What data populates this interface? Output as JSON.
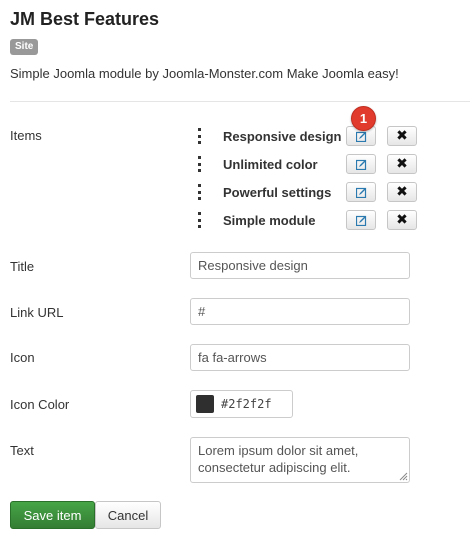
{
  "module": {
    "title": "JM Best Features",
    "badge": "Site",
    "description": "Simple Joomla module by Joomla-Monster.com Make Joomla easy!"
  },
  "items_section": {
    "label": "Items",
    "notification_count": "1",
    "items": [
      {
        "label": "Responsive design"
      },
      {
        "label": "Unlimited color"
      },
      {
        "label": "Powerful settings"
      },
      {
        "label": "Simple module"
      }
    ],
    "icons": {
      "drag": "drag-handle-icon",
      "edit": "edit-icon",
      "remove": "remove-icon"
    }
  },
  "form": {
    "title": {
      "label": "Title",
      "value": "Responsive design"
    },
    "link_url": {
      "label": "Link URL",
      "value": "#"
    },
    "icon": {
      "label": "Icon",
      "value": "fa fa-arrows"
    },
    "icon_color": {
      "label": "Icon Color",
      "value": "#2f2f2f",
      "swatch": "#2f2f2f"
    },
    "text": {
      "label": "Text",
      "value": "Lorem ipsum dolor sit amet, consectetur adipiscing elit."
    }
  },
  "actions": {
    "save": "Save item",
    "cancel": "Cancel"
  },
  "colors": {
    "primary_button": "#46a546",
    "badge": "#999999",
    "notification": "#e03b2c",
    "edit_icon": "#2a7ab0"
  }
}
